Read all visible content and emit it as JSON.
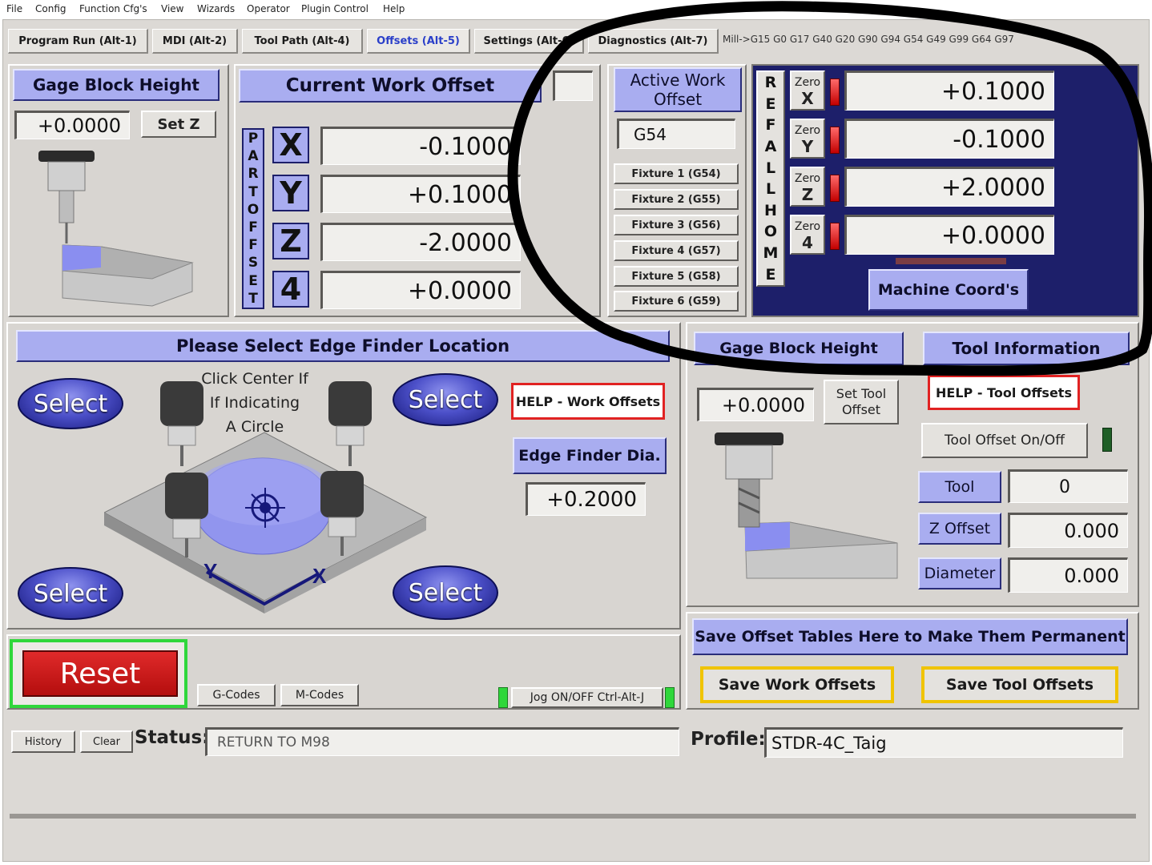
{
  "menu": [
    "File",
    "Config",
    "Function Cfg's",
    "View",
    "Wizards",
    "Operator",
    "Plugin Control",
    "Help"
  ],
  "tabs": [
    {
      "label": "Program Run (Alt-1)"
    },
    {
      "label": "MDI (Alt-2)"
    },
    {
      "label": "Tool Path (Alt-4)"
    },
    {
      "label": "Offsets (Alt-5)"
    },
    {
      "label": "Settings (Alt-6)"
    },
    {
      "label": "Diagnostics (Alt-7)"
    }
  ],
  "active_tab": "Offsets (Alt-5)",
  "gcode_modes": "Mill->G15  G0 G17 G40 G20 G90 G94 G54 G49 G99 G64 G97",
  "gage_block_left": {
    "title": "Gage Block Height",
    "value": "+0.0000",
    "set_button": "Set Z"
  },
  "current_work_offset": {
    "title": "Current Work Offset",
    "side_label": "PART OFFSET",
    "axes": [
      {
        "axis": "X",
        "value": "-0.1000"
      },
      {
        "axis": "Y",
        "value": "+0.1000"
      },
      {
        "axis": "Z",
        "value": "-2.0000"
      },
      {
        "axis": "4",
        "value": "+0.0000"
      }
    ]
  },
  "active_work_offset": {
    "title": "Active Work Offset",
    "value": "G54",
    "fixtures": [
      "Fixture 1 (G54)",
      "Fixture 2 (G55)",
      "Fixture 3 (G56)",
      "Fixture 4 (G57)",
      "Fixture 5 (G58)",
      "Fixture 6 (G59)"
    ]
  },
  "ref_all_home": {
    "side_label": "REF ALL HOME",
    "zeros": [
      {
        "zero": "Zero",
        "axis": "X",
        "value": "+0.1000"
      },
      {
        "zero": "Zero",
        "axis": "Y",
        "value": "-0.1000"
      },
      {
        "zero": "Zero",
        "axis": "Z",
        "value": "+2.0000"
      },
      {
        "zero": "Zero",
        "axis": "4",
        "value": "+0.0000"
      }
    ],
    "machine_coords_button": "Machine Coord's"
  },
  "edge_finder": {
    "title": "Please Select Edge Finder Location",
    "select_label": "Select",
    "center_text": [
      "Click Center If",
      "If Indicating",
      "A Circle"
    ],
    "axis_y": "Y",
    "axis_x": "X",
    "help_button": "HELP - Work Offsets",
    "dia_label": "Edge Finder Dia.",
    "dia_value": "+0.2000"
  },
  "gage_block_right": {
    "title": "Gage Block Height",
    "value": "+0.0000",
    "set_button": "Set Tool Offset"
  },
  "tool_info": {
    "title": "Tool Information",
    "help_button": "HELP - Tool Offsets",
    "toggle_button": "Tool Offset On/Off",
    "rows": [
      {
        "label": "Tool",
        "value": "0"
      },
      {
        "label": "Z Offset",
        "value": "0.000"
      },
      {
        "label": "Diameter",
        "value": "0.000"
      }
    ]
  },
  "save": {
    "title": "Save Offset Tables Here to Make Them Permanent",
    "work_button": "Save Work Offsets",
    "tool_button": "Save Tool Offsets"
  },
  "bottom": {
    "reset": "Reset",
    "gcodes": "G-Codes",
    "mcodes": "M-Codes",
    "jog": "Jog ON/OFF Ctrl-Alt-J"
  },
  "status": {
    "history": "History",
    "clear": "Clear",
    "label": "Status:",
    "value": "RETURN TO M98",
    "profile_label": "Profile:",
    "profile_value": "STDR-4C_Taig"
  }
}
